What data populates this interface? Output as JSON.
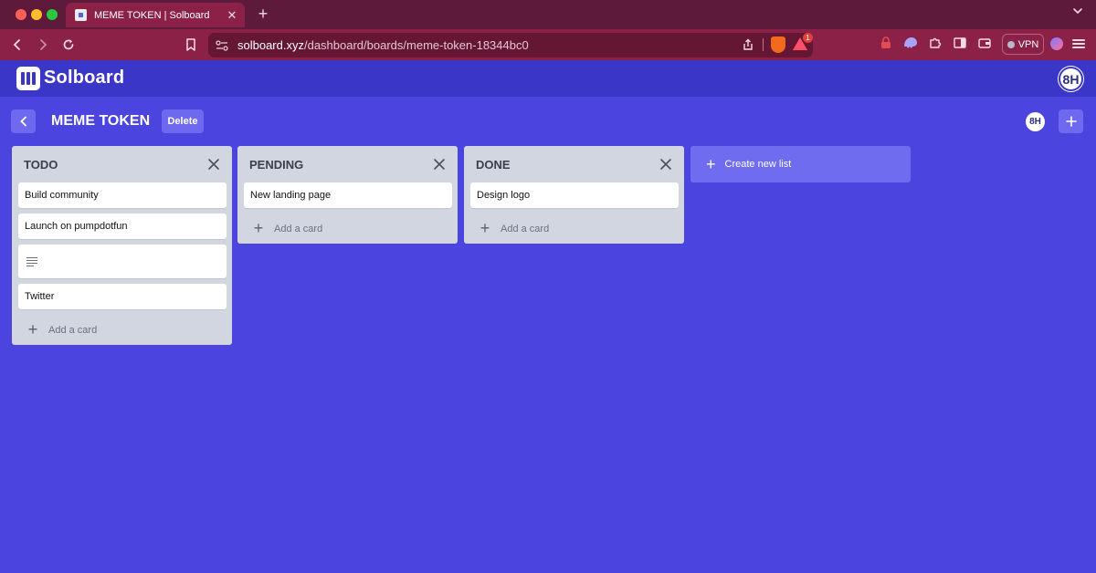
{
  "browser": {
    "tab_title": "MEME TOKEN | Solboard",
    "tab_close": "✕",
    "new_tab": "+",
    "url_host": "solboard.xyz",
    "url_path": "/dashboard/boards/meme-token-18344bc0",
    "rewards_badge": "1",
    "vpn_label": "VPN"
  },
  "app": {
    "logo_text": "Solboard",
    "user_initials": "8H"
  },
  "board": {
    "title": "MEME TOKEN",
    "delete_label": "Delete",
    "member_initials": "8H",
    "create_list_label": "Create new list",
    "add_card_label": "Add a card",
    "lists": [
      {
        "title": "TODO",
        "cards": [
          {
            "text": "Build community"
          },
          {
            "text": "Launch on pumpdotfun"
          },
          {
            "text": ""
          },
          {
            "text": "Twitter"
          }
        ]
      },
      {
        "title": "PENDING",
        "cards": [
          {
            "text": "New landing page"
          }
        ]
      },
      {
        "title": "DONE",
        "cards": [
          {
            "text": "Design logo"
          }
        ]
      }
    ]
  }
}
